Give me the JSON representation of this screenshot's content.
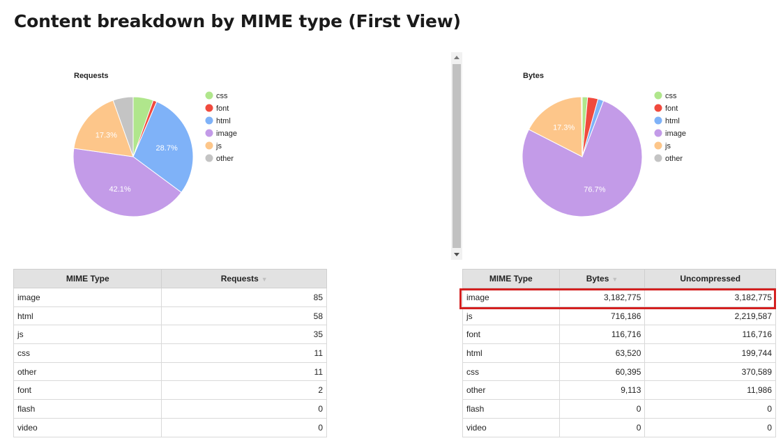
{
  "page": {
    "title": "Content breakdown by MIME type (First View)"
  },
  "colors": {
    "css": "#b0e68c",
    "font": "#f04a3e",
    "html": "#7fb2f8",
    "image": "#c39be8",
    "js": "#fdc68a",
    "other": "#c4c4c4",
    "highlight": "#d42020"
  },
  "chart_data": [
    {
      "type": "pie",
      "title": "Requests",
      "slices": [
        {
          "label": "css",
          "value": 11
        },
        {
          "label": "font",
          "value": 2
        },
        {
          "label": "html",
          "value": 58
        },
        {
          "label": "image",
          "value": 85
        },
        {
          "label": "js",
          "value": 35
        },
        {
          "label": "other",
          "value": 11
        }
      ],
      "slice_labels": [
        {
          "label": "html",
          "text": "28.7%"
        },
        {
          "label": "image",
          "text": "42.1%"
        },
        {
          "label": "js",
          "text": "17.3%"
        }
      ],
      "legend": [
        "css",
        "font",
        "html",
        "image",
        "js",
        "other"
      ],
      "legend_position": "right"
    },
    {
      "type": "pie",
      "title": "Bytes",
      "slices": [
        {
          "label": "css",
          "value": 60395
        },
        {
          "label": "font",
          "value": 116716
        },
        {
          "label": "html",
          "value": 63520
        },
        {
          "label": "image",
          "value": 3182775
        },
        {
          "label": "js",
          "value": 716186
        },
        {
          "label": "other",
          "value": 9113
        }
      ],
      "slice_labels": [
        {
          "label": "image",
          "text": "76.7%"
        },
        {
          "label": "js",
          "text": "17.3%"
        }
      ],
      "legend": [
        "css",
        "font",
        "html",
        "image",
        "js",
        "other"
      ],
      "legend_position": "right"
    }
  ],
  "requests_table": {
    "headers": [
      "MIME Type",
      "Requests"
    ],
    "sort_indicator": "▼",
    "rows": [
      [
        "image",
        "85"
      ],
      [
        "html",
        "58"
      ],
      [
        "js",
        "35"
      ],
      [
        "css",
        "11"
      ],
      [
        "other",
        "11"
      ],
      [
        "font",
        "2"
      ],
      [
        "flash",
        "0"
      ],
      [
        "video",
        "0"
      ]
    ]
  },
  "bytes_table": {
    "headers": [
      "MIME Type",
      "Bytes",
      "Uncompressed"
    ],
    "sort_indicator": "▼",
    "rows": [
      [
        "image",
        "3,182,775",
        "3,182,775"
      ],
      [
        "js",
        "716,186",
        "2,219,587"
      ],
      [
        "font",
        "116,716",
        "116,716"
      ],
      [
        "html",
        "63,520",
        "199,744"
      ],
      [
        "css",
        "60,395",
        "370,589"
      ],
      [
        "other",
        "9,113",
        "11,986"
      ],
      [
        "flash",
        "0",
        "0"
      ],
      [
        "video",
        "0",
        "0"
      ]
    ]
  }
}
